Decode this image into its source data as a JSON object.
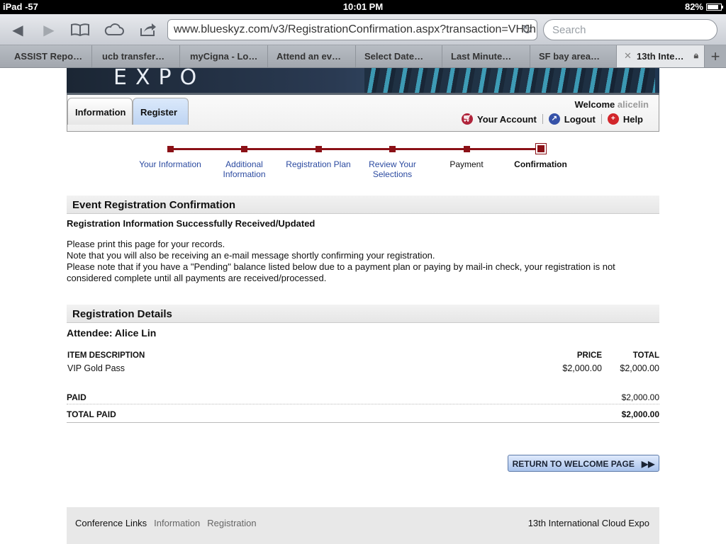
{
  "status": {
    "device": "iPad -57",
    "time": "10:01 PM",
    "battery": "82%",
    "battery_level": 0.82
  },
  "browser": {
    "url": "www.blueskyz.com/v3/RegistrationConfirmation.aspx?transaction=VHJhb",
    "search_placeholder": "Search",
    "tabs": [
      "ASSIST Repo…",
      "ucb transfer…",
      "myCigna - Lo…",
      "Attend an ev…",
      "Select Date…",
      "Last Minute…",
      "SF bay area…",
      "13th Inte…"
    ]
  },
  "site": {
    "banner_text": "EXPO",
    "nav": {
      "information": "Information",
      "register": "Register"
    },
    "welcome_label": "Welcome",
    "username": "alicelin",
    "links": {
      "account": "Your Account",
      "logout": "Logout",
      "help": "Help"
    }
  },
  "steps": [
    {
      "label": "Your Information",
      "style": "link"
    },
    {
      "label": "Additional Information",
      "style": "link"
    },
    {
      "label": "Registration Plan",
      "style": "link"
    },
    {
      "label": "Review Your Selections",
      "style": "link"
    },
    {
      "label": "Payment",
      "style": "plain"
    },
    {
      "label": "Confirmation",
      "style": "current"
    }
  ],
  "confirmation": {
    "heading": "Event Registration Confirmation",
    "subheading": "Registration Information Successfully Received/Updated",
    "notes": [
      "Please print this page for your records.",
      "Note that you will also be receiving an e-mail message shortly confirming your registration.",
      "Please note that if you have a \"Pending\" balance listed below due to a payment plan or paying by mail-in check, your registration is not considered complete until all payments are received/processed."
    ]
  },
  "details": {
    "heading": "Registration Details",
    "attendee": "Attendee: Alice Lin",
    "columns": {
      "description": "ITEM DESCRIPTION",
      "price": "PRICE",
      "total": "TOTAL"
    },
    "items": [
      {
        "description": "VIP Gold Pass",
        "price": "$2,000.00",
        "total": "$2,000.00"
      }
    ],
    "paid_label": "PAID",
    "paid_value": "$2,000.00",
    "total_paid_label": "TOTAL PAID",
    "total_paid_value": "$2,000.00"
  },
  "return_button": "RETURN TO WELCOME PAGE",
  "footer": {
    "conference_links": "Conference Links",
    "information": "Information",
    "registration": "Registration",
    "brand": "13th International Cloud Expo"
  }
}
